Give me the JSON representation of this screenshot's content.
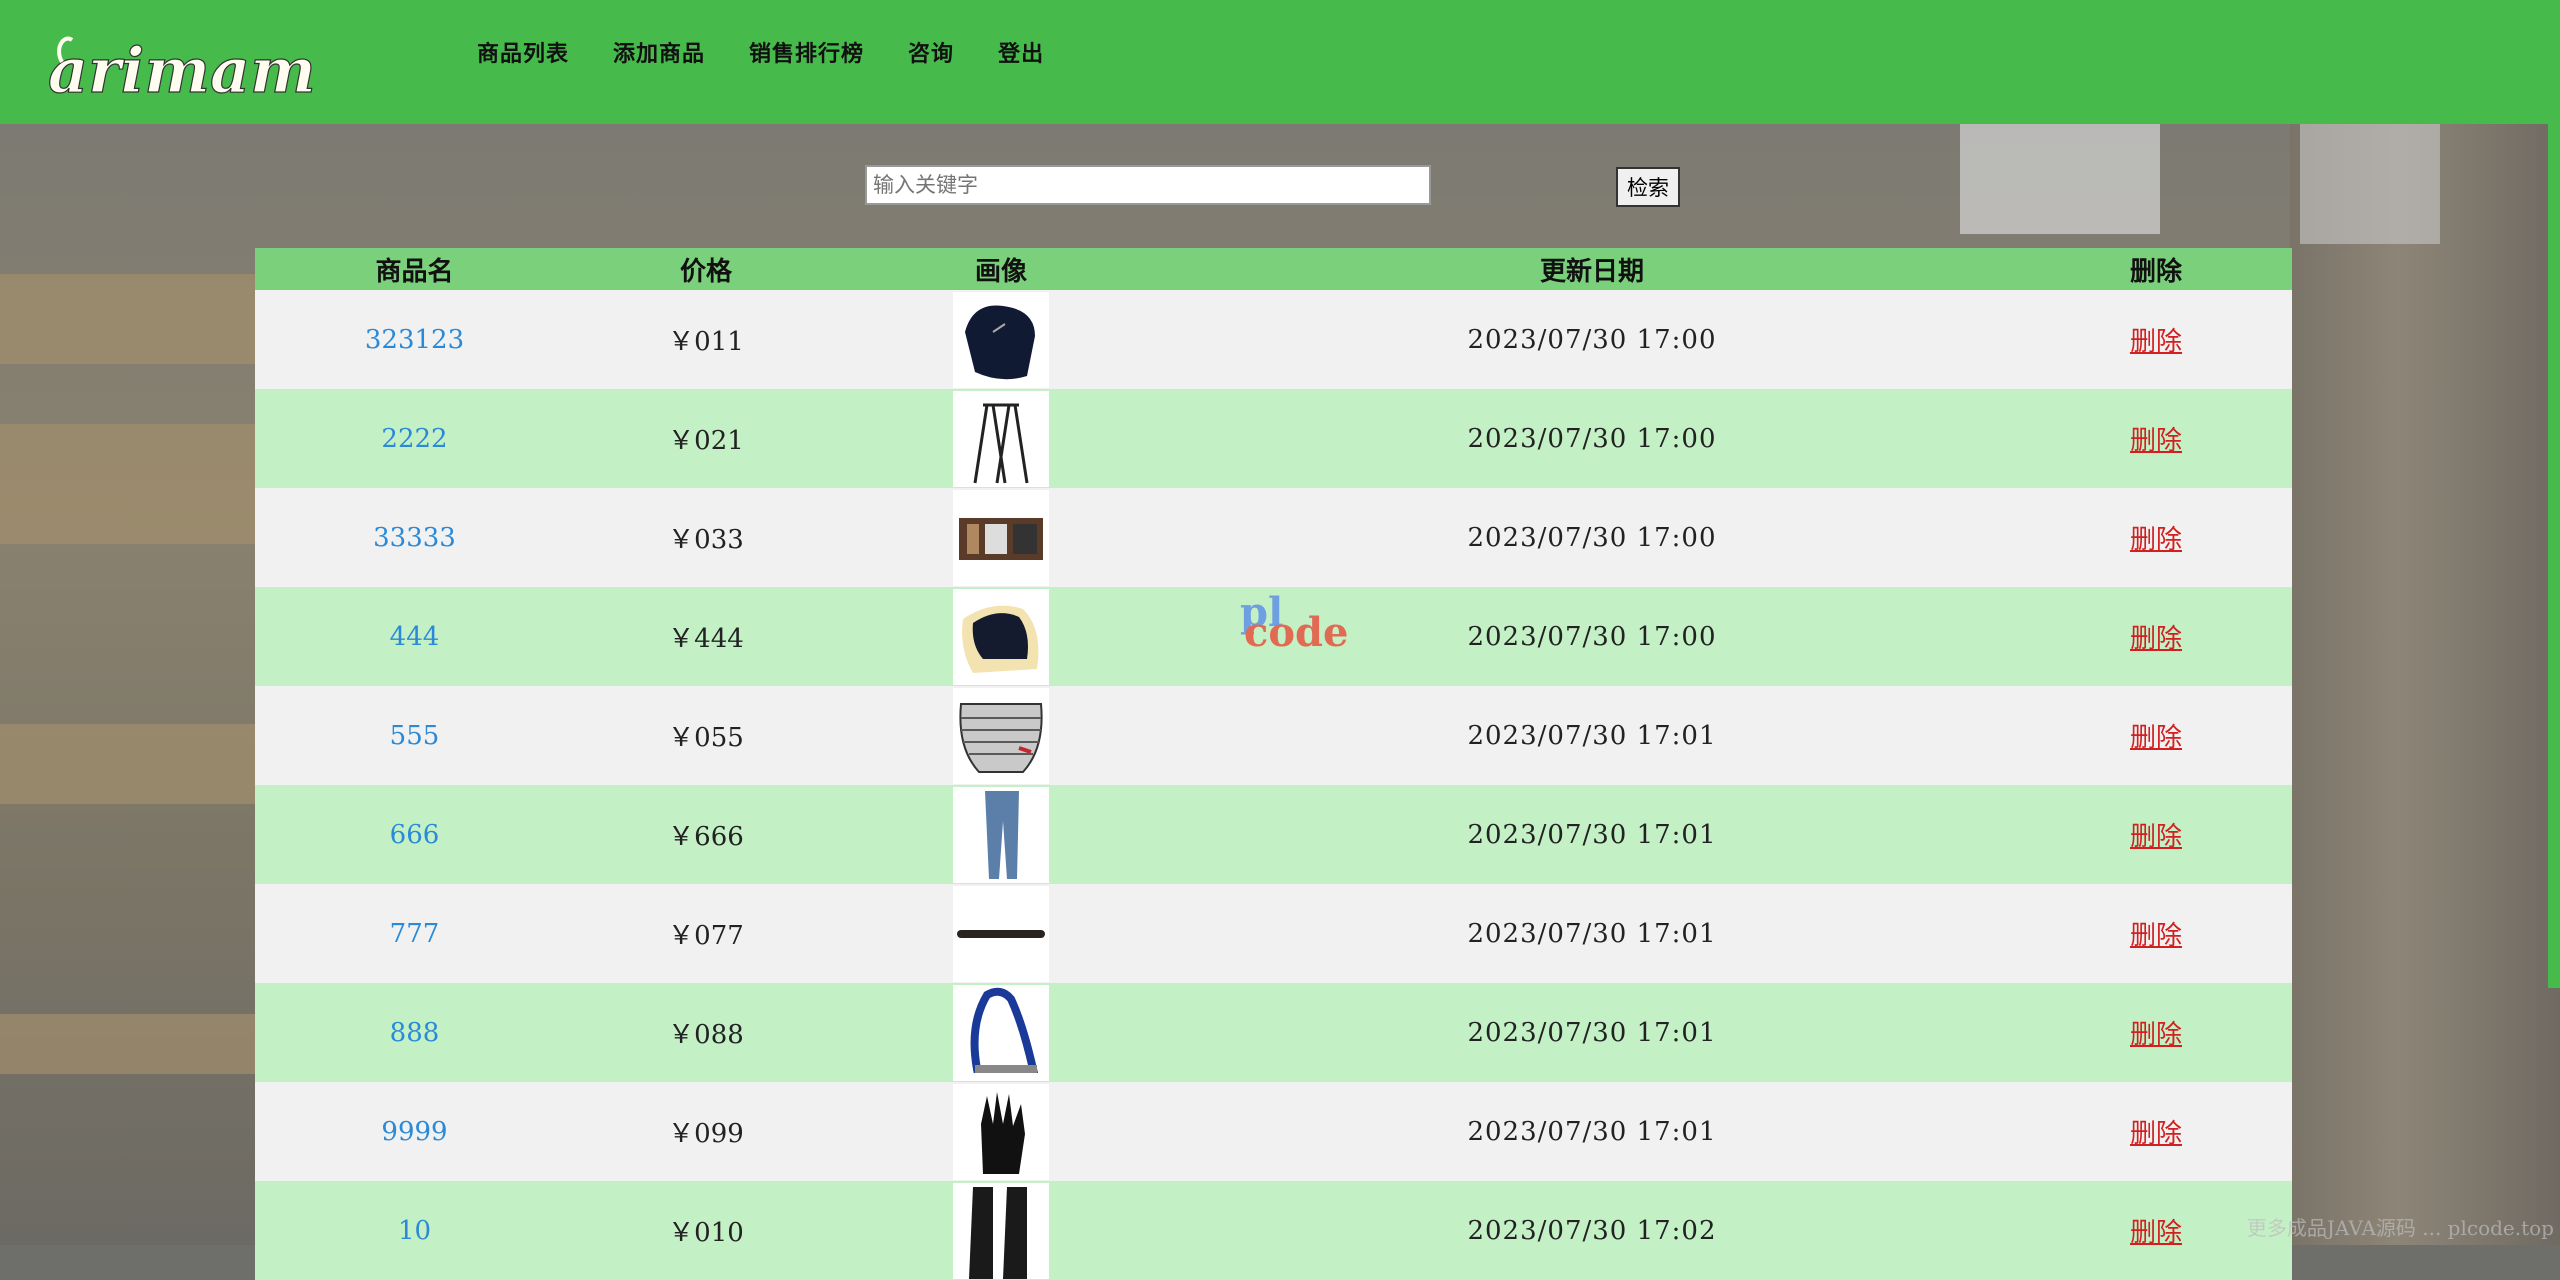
{
  "header": {
    "logo_text": "arimama",
    "nav": [
      "商品列表",
      "添加商品",
      "销售排行榜",
      "咨询",
      "登出"
    ]
  },
  "search": {
    "placeholder": "输入关键字",
    "button_label": "检索"
  },
  "table": {
    "columns": [
      "商品名",
      "价格",
      "画像",
      "更新日期",
      "删除"
    ],
    "rows": [
      {
        "name": "323123",
        "price": "￥011",
        "image": "saddle-black",
        "date": "2023/07/30 17:00",
        "delete": "删除"
      },
      {
        "name": "2222",
        "price": "￥021",
        "image": "saddle-stand",
        "date": "2023/07/30 17:00",
        "delete": "删除"
      },
      {
        "name": "33333",
        "price": "￥033",
        "image": "grooming-kit",
        "date": "2023/07/30 17:00",
        "delete": "删除"
      },
      {
        "name": "444",
        "price": "￥444",
        "image": "fleece-pad",
        "date": "2023/07/30 17:00",
        "delete": "删除"
      },
      {
        "name": "555",
        "price": "￥055",
        "image": "saddle-pad-striped",
        "date": "2023/07/30 17:01",
        "delete": "删除"
      },
      {
        "name": "666",
        "price": "￥666",
        "image": "riding-breeches",
        "date": "2023/07/30 17:01",
        "delete": "删除"
      },
      {
        "name": "777",
        "price": "￥077",
        "image": "girth",
        "date": "2023/07/30 17:01",
        "delete": "删除"
      },
      {
        "name": "888",
        "price": "￥088",
        "image": "stirrup-blue",
        "date": "2023/07/30 17:01",
        "delete": "删除"
      },
      {
        "name": "9999",
        "price": "￥099",
        "image": "riding-glove",
        "date": "2023/07/30 17:01",
        "delete": "删除"
      },
      {
        "name": "10",
        "price": "￥010",
        "image": "riding-boots",
        "date": "2023/07/30 17:02",
        "delete": "删除"
      }
    ]
  },
  "watermark": {
    "line1": "pl",
    "line2": "code"
  },
  "footer_mark": "更多成品JAVA源码 ... plcode.top",
  "colors": {
    "header_green": "#46bb4b",
    "row_green": "#c4f0c6",
    "row_gray": "#f1f1f1",
    "head_green": "#7bd07b",
    "link_blue": "#2a8ad8",
    "delete_red": "#d21f1f"
  }
}
